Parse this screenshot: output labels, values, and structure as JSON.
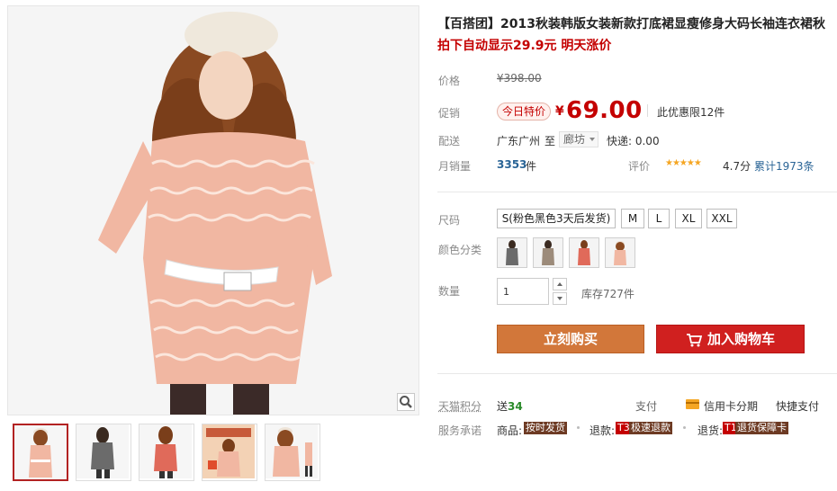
{
  "product": {
    "title": "【百搭团】2013秋装韩版女装新款打底裙显瘦修身大码长袖连衣裙秋",
    "subtitle": "拍下自动显示29.9元 明天涨价"
  },
  "price": {
    "label": "价格",
    "currency": "¥",
    "original": "398.00"
  },
  "promo": {
    "label": "促销",
    "badge": "今日特价",
    "currency": "¥",
    "price": "69.00",
    "limit": "此优惠限12件"
  },
  "shipping": {
    "label": "配送",
    "origin": "广东广州",
    "to": "至",
    "destination": "廊坊",
    "fee": "快递: 0.00"
  },
  "sales": {
    "label": "月销量",
    "count": "3353",
    "unit": "件",
    "rating_label": "评价",
    "stars": "★★★★★",
    "score": "4.7分",
    "total_reviews": "累计1973条"
  },
  "size": {
    "label": "尺码",
    "options": [
      "S(粉色黑色3天后发货)",
      "M",
      "L",
      "XL",
      "XXL"
    ]
  },
  "color": {
    "label": "颜色分类",
    "swatches": [
      "grey",
      "taupe",
      "coral",
      "pink"
    ]
  },
  "quantity": {
    "label": "数量",
    "value": "1",
    "stock": "库存727件"
  },
  "actions": {
    "buy_now": "立刻购买",
    "add_to_cart": "加入购物车"
  },
  "points": {
    "label": "天猫积分",
    "prefix": "送",
    "value": "34"
  },
  "payment": {
    "label": "支付",
    "credit": "信用卡分期",
    "quick": "快捷支付"
  },
  "service": {
    "label": "服务承诺",
    "goods_label": "商品:",
    "goods_tag": "按时发货",
    "return_label": "退款:",
    "return_code": "T3",
    "return_tag": "极速退款",
    "exchange_label": "退货:",
    "exchange_code": "T1",
    "exchange_tag": "退货保障卡"
  },
  "colors": {
    "accent_red": "#c40000",
    "buy_orange": "#d2773a",
    "cart_red": "#d0201f",
    "link_blue": "#2a6496"
  }
}
